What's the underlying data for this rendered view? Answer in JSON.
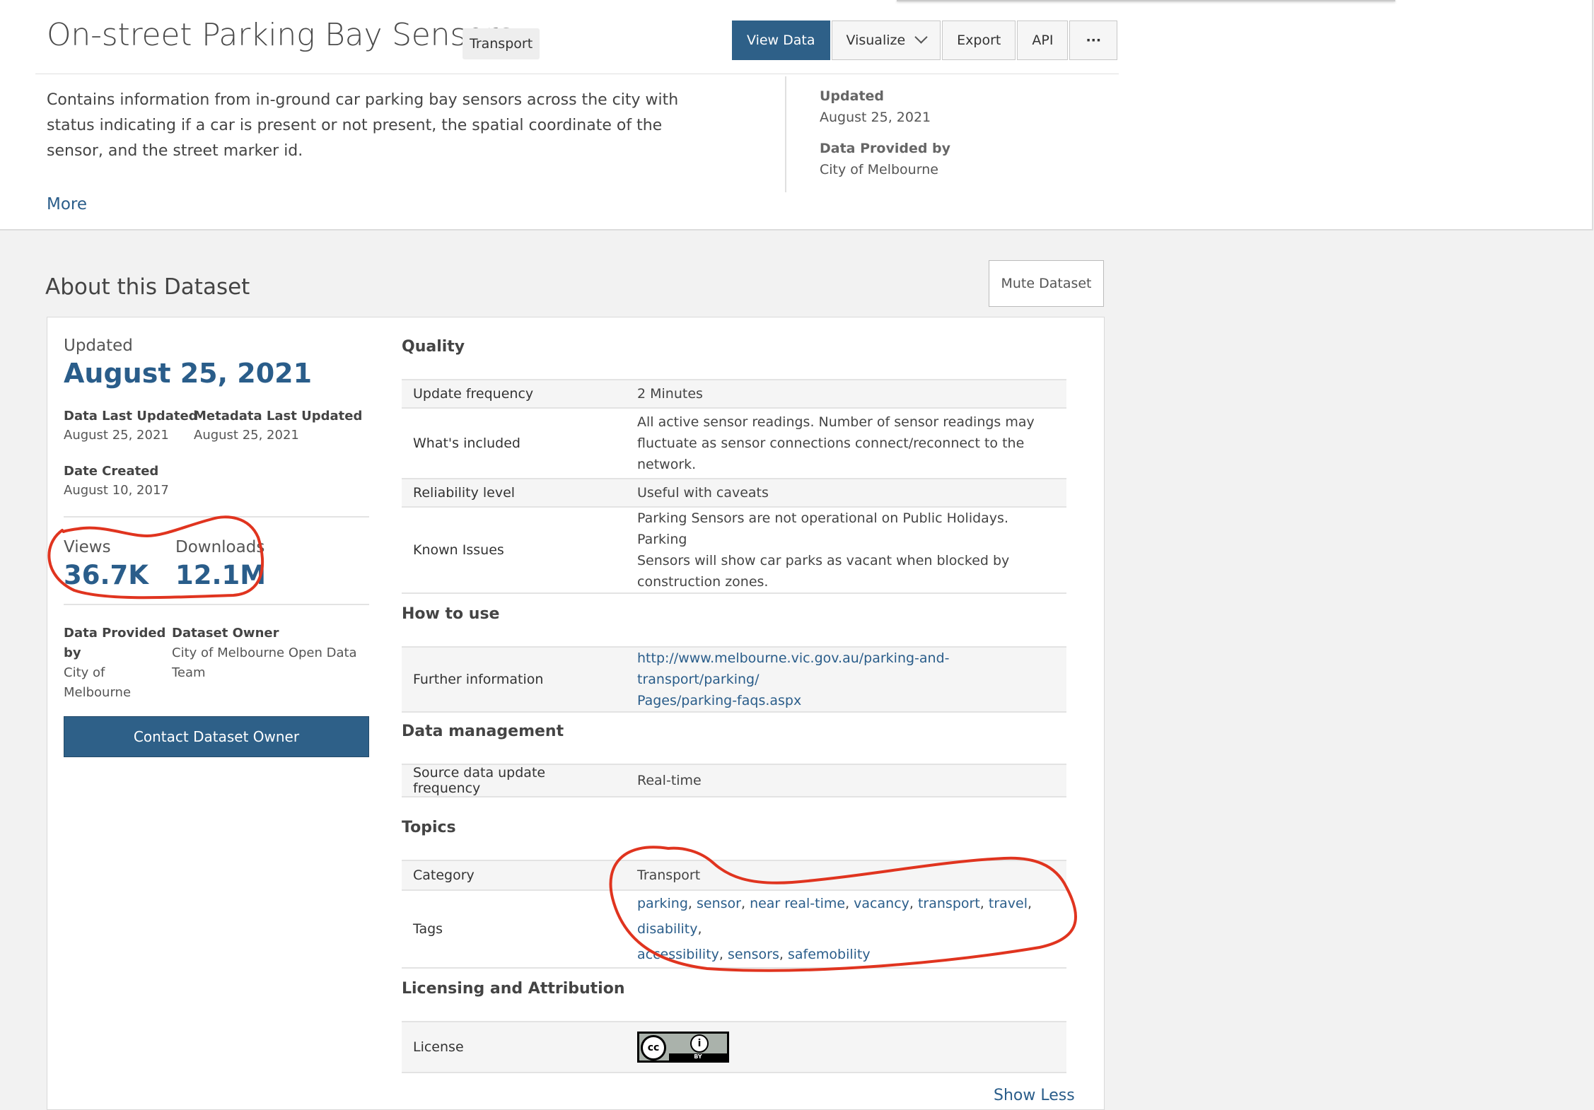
{
  "header": {
    "title": "On-street Parking Bay Sensors",
    "category": "Transport",
    "buttons": {
      "view_data": "View Data",
      "visualize": "Visualize",
      "export": "Export",
      "api": "API",
      "more": "···"
    },
    "description": "Contains information from in-ground car parking bay sensors across the city with status indicating if a car is present or not present, the spatial coordinate of the sensor, and the street marker id.",
    "more_link": "More",
    "meta": {
      "updated_label": "Updated",
      "updated_value": "August 25, 2021",
      "provided_label": "Data Provided by",
      "provided_value": "City of Melbourne"
    }
  },
  "about": {
    "title": "About this Dataset",
    "mute_button": "Mute Dataset",
    "left": {
      "updated_label": "Updated",
      "updated_date": "August 25, 2021",
      "data_last_updated_label": "Data Last Updated",
      "data_last_updated_value": "August 25, 2021",
      "metadata_last_updated_label": "Metadata Last Updated",
      "metadata_last_updated_value": "August 25, 2021",
      "date_created_label": "Date Created",
      "date_created_value": "August 10, 2017",
      "views_label": "Views",
      "views_value": "36.7K",
      "downloads_label": "Downloads",
      "downloads_value": "12.1M",
      "provided_label_1": "Data Provided",
      "provided_label_2": "by",
      "provided_value_1": "City of",
      "provided_value_2": "Melbourne",
      "owner_label": "Dataset Owner",
      "owner_value_1": "City of Melbourne Open Data",
      "owner_value_2": "Team",
      "contact_button": "Contact Dataset Owner"
    },
    "quality": {
      "heading": "Quality",
      "rows": [
        {
          "key": "Update frequency",
          "value": "2 Minutes"
        },
        {
          "key": "What's included",
          "value_lines": [
            "All active sensor readings. Number of sensor readings may",
            "fluctuate as sensor connections connect/reconnect to the",
            "network."
          ]
        },
        {
          "key": "Reliability level",
          "value": "Useful with caveats"
        },
        {
          "key": "Known Issues",
          "value_lines": [
            "Parking Sensors are not operational on Public Holidays. Parking",
            "Sensors will show car parks as vacant when blocked by",
            "construction zones."
          ]
        }
      ]
    },
    "how_to_use": {
      "heading": "How to use",
      "key": "Further information",
      "link_line1": "http://www.melbourne.vic.gov.au/parking-and-transport/parking/",
      "link_line2": "Pages/parking-faqs.aspx"
    },
    "data_management": {
      "heading": "Data management",
      "key": "Source data update frequency",
      "value": "Real-time"
    },
    "topics": {
      "heading": "Topics",
      "category_key": "Category",
      "category_value": "Transport",
      "tags_key": "Tags",
      "tags": [
        "parking",
        "sensor",
        "near real-time",
        "vacancy",
        "transport",
        "travel",
        "disability",
        "accessibility",
        "sensors",
        "safemobility"
      ]
    },
    "licensing": {
      "heading": "Licensing and Attribution",
      "key": "License",
      "badge_cc": "cc",
      "badge_by": "BY"
    },
    "show_less": "Show Less"
  },
  "colors": {
    "accent": "#2e6088",
    "link": "#2a5d8a",
    "annotation": "#e0341f"
  }
}
